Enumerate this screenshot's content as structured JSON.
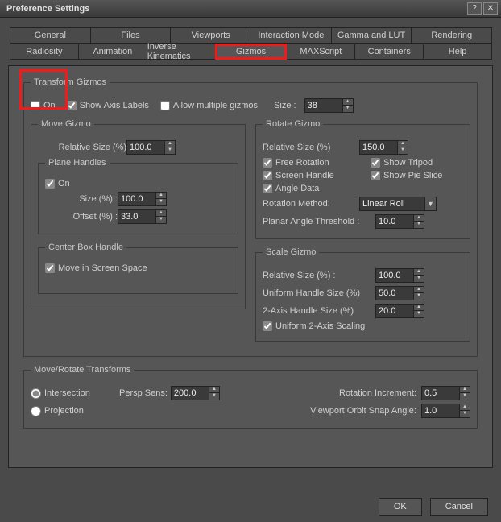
{
  "window": {
    "title": "Preference Settings"
  },
  "tabs_row1": [
    "General",
    "Files",
    "Viewports",
    "Interaction Mode",
    "Gamma and LUT",
    "Rendering"
  ],
  "tabs_row2": [
    "Radiosity",
    "Animation",
    "Inverse Kinematics",
    "Gizmos",
    "MAXScript",
    "Containers",
    "Help"
  ],
  "active_tab": "Gizmos",
  "transformGizmos": {
    "legend": "Transform Gizmos",
    "on_label": "On",
    "on_checked": false,
    "showAxisLabels_label": "Show Axis Labels",
    "showAxisLabels_checked": true,
    "allowMultiple_label": "Allow multiple gizmos",
    "allowMultiple_checked": false,
    "size_label": "Size :",
    "size_value": "38"
  },
  "moveGizmo": {
    "legend": "Move Gizmo",
    "relSize_label": "Relative Size (%)",
    "relSize_value": "100.0",
    "planeHandles": {
      "legend": "Plane Handles",
      "on_label": "On",
      "on_checked": true,
      "size_label": "Size (%) :",
      "size_value": "100.0",
      "offset_label": "Offset (%) :",
      "offset_value": "33.0"
    },
    "centerBox": {
      "legend": "Center Box Handle",
      "moveScreen_label": "Move in Screen Space",
      "moveScreen_checked": true
    }
  },
  "rotateGizmo": {
    "legend": "Rotate Gizmo",
    "relSize_label": "Relative Size (%)",
    "relSize_value": "150.0",
    "freeRotation_label": "Free Rotation",
    "freeRotation_checked": true,
    "showTripod_label": "Show Tripod",
    "showTripod_checked": true,
    "screenHandle_label": "Screen Handle",
    "screenHandle_checked": true,
    "showPieSlice_label": "Show Pie Slice",
    "showPieSlice_checked": true,
    "angleData_label": "Angle Data",
    "angleData_checked": true,
    "rotationMethod_label": "Rotation Method:",
    "rotationMethod_value": "Linear Roll",
    "planarThreshold_label": "Planar Angle Threshold :",
    "planarThreshold_value": "10.0"
  },
  "scaleGizmo": {
    "legend": "Scale Gizmo",
    "relSize_label": "Relative Size (%) :",
    "relSize_value": "100.0",
    "uniformHandle_label": "Uniform Handle Size (%)",
    "uniformHandle_value": "50.0",
    "twoAxis_label": "2-Axis Handle Size (%)",
    "twoAxis_value": "20.0",
    "uniform2Axis_label": "Uniform 2-Axis Scaling",
    "uniform2Axis_checked": true
  },
  "moveRotate": {
    "legend": "Move/Rotate Transforms",
    "intersection_label": "Intersection",
    "intersection_checked": true,
    "projection_label": "Projection",
    "projection_checked": false,
    "perspSens_label": "Persp Sens:",
    "perspSens_value": "200.0",
    "rotationInc_label": "Rotation Increment:",
    "rotationInc_value": "0.5",
    "viewportOrbit_label": "Viewport Orbit Snap Angle:",
    "viewportOrbit_value": "1.0"
  },
  "buttons": {
    "ok": "OK",
    "cancel": "Cancel"
  }
}
